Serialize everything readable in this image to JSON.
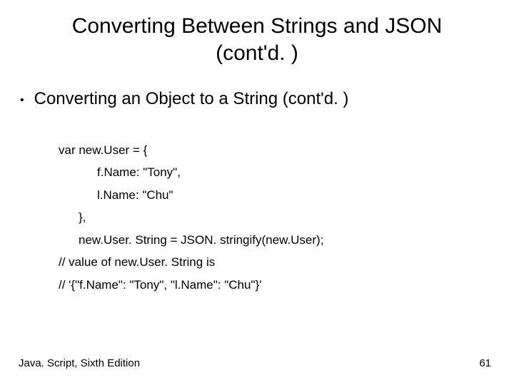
{
  "title_line1": "Converting Between Strings and JSON",
  "title_line2": "(cont'd. )",
  "bullet": "Converting an Object to a String (cont'd. )",
  "code": {
    "l1": "var new.User = {",
    "l2": "f.Name: \"Tony\",",
    "l3": "l.Name: \"Chu\"",
    "l4": "},",
    "l5": "new.User. String = JSON. stringify(new.User);",
    "l6": "// value of new.User. String is",
    "l7": "// '{\"f.Name\": \"Tony\", \"l.Name\": \"Chu\"}'"
  },
  "footer_left": "Java. Script, Sixth Edition",
  "footer_right": "61"
}
